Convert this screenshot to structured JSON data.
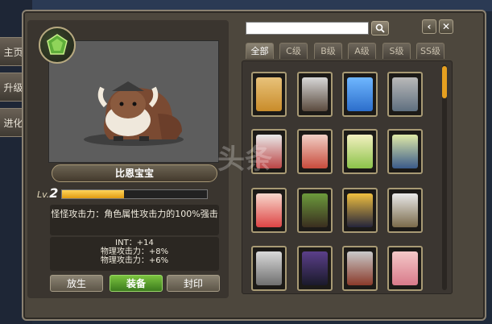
{
  "side_tabs": [
    "主页",
    "升级",
    "进化"
  ],
  "monster": {
    "name": "比恩宝宝",
    "level_prefix": "Lv.",
    "level": "2",
    "xp_fraction": 0.43,
    "description": "怪怪攻击力：角色属性攻击力的100%强击",
    "stats": [
      "INT：+14",
      "物理攻击力：+8%",
      "物理攻击力：+6%"
    ]
  },
  "buttons": {
    "release": "放生",
    "equip": "装备",
    "seal": "封印"
  },
  "search": {
    "placeholder": "",
    "value": ""
  },
  "controls": {
    "back_icon": "chevron-left-icon",
    "close_icon": "close-icon",
    "search_icon": "search-icon"
  },
  "tabs": [
    "全部",
    "C级",
    "B级",
    "A级",
    "S级",
    "SS级"
  ],
  "active_tab": "全部",
  "cards": [
    {
      "color": "#e8c27a",
      "accent": "#c98c2a"
    },
    {
      "color": "#d7d7d7",
      "accent": "#5a4a3d"
    },
    {
      "color": "#6fb7ff",
      "accent": "#2c6ecb"
    },
    {
      "color": "#b9b9b9",
      "accent": "#5f6f7f"
    },
    {
      "color": "#e9e9e9",
      "accent": "#b44"
    },
    {
      "color": "#f2d0c6",
      "accent": "#c84b3c"
    },
    {
      "color": "#f3f0c0",
      "accent": "#8cc34a"
    },
    {
      "color": "#dfe9a8",
      "accent": "#3a5a8a"
    },
    {
      "color": "#f8d8cc",
      "accent": "#d44"
    },
    {
      "color": "#6c9a3c",
      "accent": "#3a2e1f"
    },
    {
      "color": "#f0c040",
      "accent": "#24243a"
    },
    {
      "color": "#e9e9e9",
      "accent": "#7a6a4a"
    },
    {
      "color": "#d9d9d9",
      "accent": "#6f6f6f"
    },
    {
      "color": "#5b3f8a",
      "accent": "#1a1a2a"
    },
    {
      "color": "#c9c9c9",
      "accent": "#8a3a2a"
    },
    {
      "color": "#f4c8c8",
      "accent": "#d87a8a"
    }
  ],
  "watermark": "头条"
}
